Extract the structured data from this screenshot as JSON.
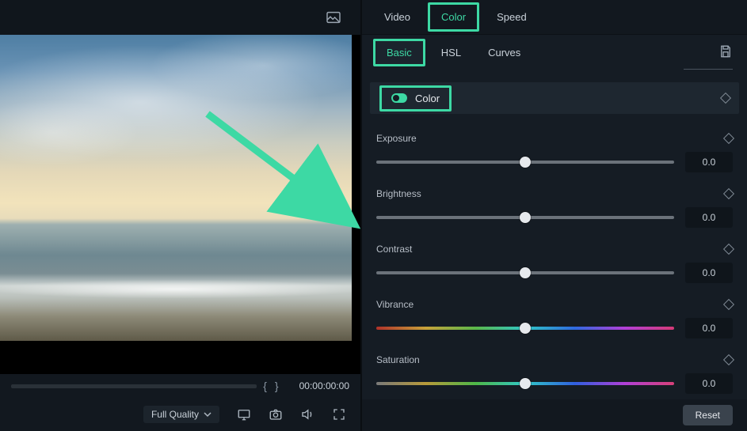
{
  "preview": {
    "quality_label": "Full Quality",
    "timecode": "00:00:00:00"
  },
  "top_tabs": {
    "items": [
      {
        "label": "Video",
        "active": false
      },
      {
        "label": "Color",
        "active": true
      },
      {
        "label": "Speed",
        "active": false
      }
    ]
  },
  "sub_tabs": {
    "items": [
      {
        "label": "Basic",
        "active": true
      },
      {
        "label": "HSL",
        "active": false
      },
      {
        "label": "Curves",
        "active": false
      }
    ]
  },
  "color_section": {
    "title": "Color",
    "toggle_on": true
  },
  "sliders": {
    "exposure": {
      "label": "Exposure",
      "value": "0.0",
      "pos": 50,
      "track": "gray"
    },
    "brightness": {
      "label": "Brightness",
      "value": "0.0",
      "pos": 50,
      "track": "gray"
    },
    "contrast": {
      "label": "Contrast",
      "value": "0.0",
      "pos": 50,
      "track": "gray"
    },
    "vibrance": {
      "label": "Vibrance",
      "value": "0.0",
      "pos": 50,
      "track": "vibrance"
    },
    "saturation": {
      "label": "Saturation",
      "value": "0.0",
      "pos": 50,
      "track": "saturation"
    }
  },
  "reset_label": "Reset",
  "colors": {
    "accent": "#3dd9a4"
  }
}
